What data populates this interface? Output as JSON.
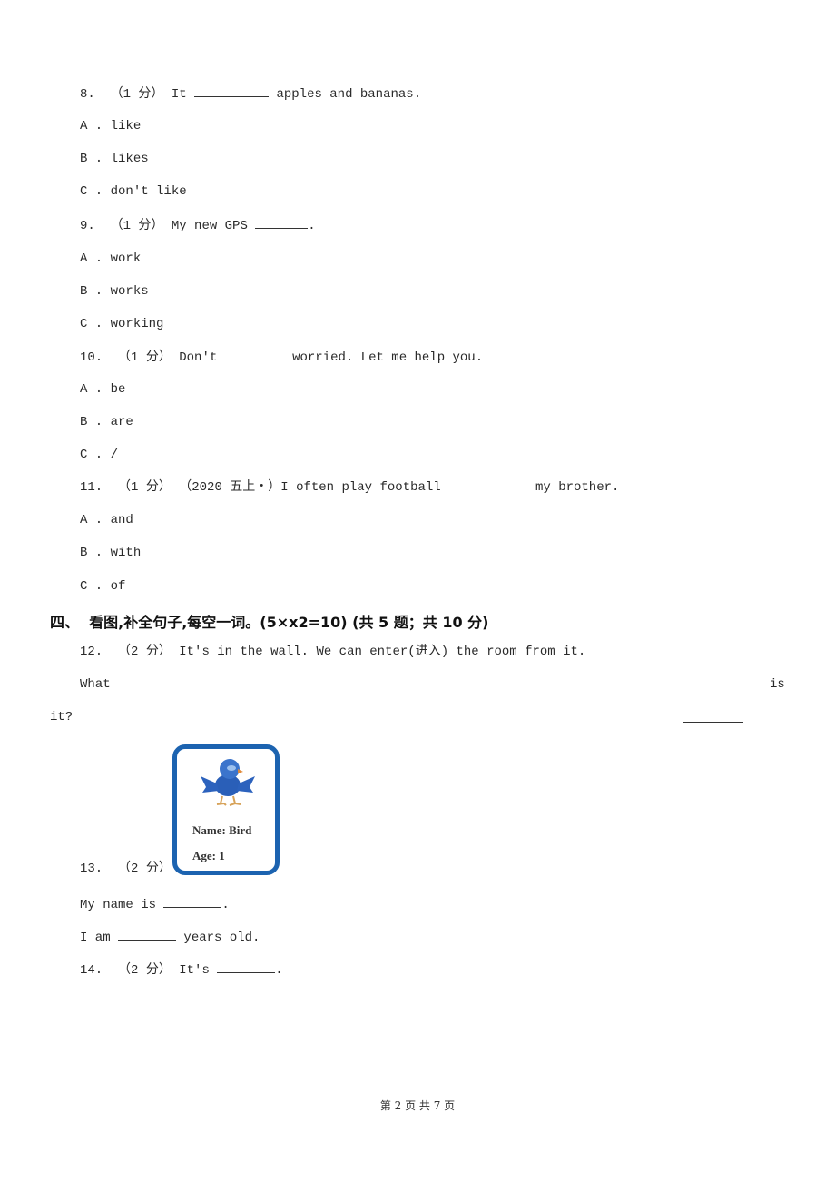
{
  "questions": [
    {
      "number": "8.",
      "score": "（1 分）",
      "stem_before": "It ",
      "stem_after": " apples and bananas.",
      "options": [
        {
          "letter": "A .",
          "text": "like"
        },
        {
          "letter": "B .",
          "text": "likes"
        },
        {
          "letter": "C .",
          "text": "don't like"
        }
      ]
    },
    {
      "number": "9.",
      "score": "（1 分）",
      "stem_before": "My new GPS ",
      "stem_after": ".",
      "options": [
        {
          "letter": "A .",
          "text": "work"
        },
        {
          "letter": "B .",
          "text": "works"
        },
        {
          "letter": "C .",
          "text": "working"
        }
      ]
    },
    {
      "number": "10.",
      "score": "（1 分）",
      "stem_before": "Don't ",
      "stem_after": " worried. Let me help you.",
      "options": [
        {
          "letter": "A .",
          "text": "be"
        },
        {
          "letter": "B .",
          "text": "are"
        },
        {
          "letter": "C .",
          "text": "/"
        }
      ]
    },
    {
      "number": "11.",
      "score": "（1 分）",
      "source": "（2020 五上・）",
      "stem_before": "I often play football",
      "stem_after": "my brother.",
      "options": [
        {
          "letter": "A .",
          "text": "and"
        },
        {
          "letter": "B .",
          "text": "with"
        },
        {
          "letter": "C .",
          "text": "of"
        }
      ]
    }
  ],
  "section": {
    "title": "四、  看图,补全句子,每空一词。(5×x2=10) (共 5 题；共 10 分)"
  },
  "q12": {
    "number": "12.",
    "score": "（2 分）",
    "prompt": "It's in the wall. We can enter(进入) the room from it.",
    "line1_left": "What",
    "line1_right": "is",
    "line2_left": "it?"
  },
  "q13": {
    "number": "13.",
    "score": "（2 分）",
    "card": {
      "name_label": "Name: Bird",
      "age_label": "Age: 1",
      "border_color": "#1c63b0"
    },
    "line1_before": "My name is ",
    "line1_after": ".",
    "line2_before": "I am ",
    "line2_after": " years old."
  },
  "q14": {
    "number": "14.",
    "score": "（2 分）",
    "stem_before": "It's ",
    "stem_after": "."
  },
  "footer": {
    "page_text": "第 2 页 共 7 页"
  }
}
